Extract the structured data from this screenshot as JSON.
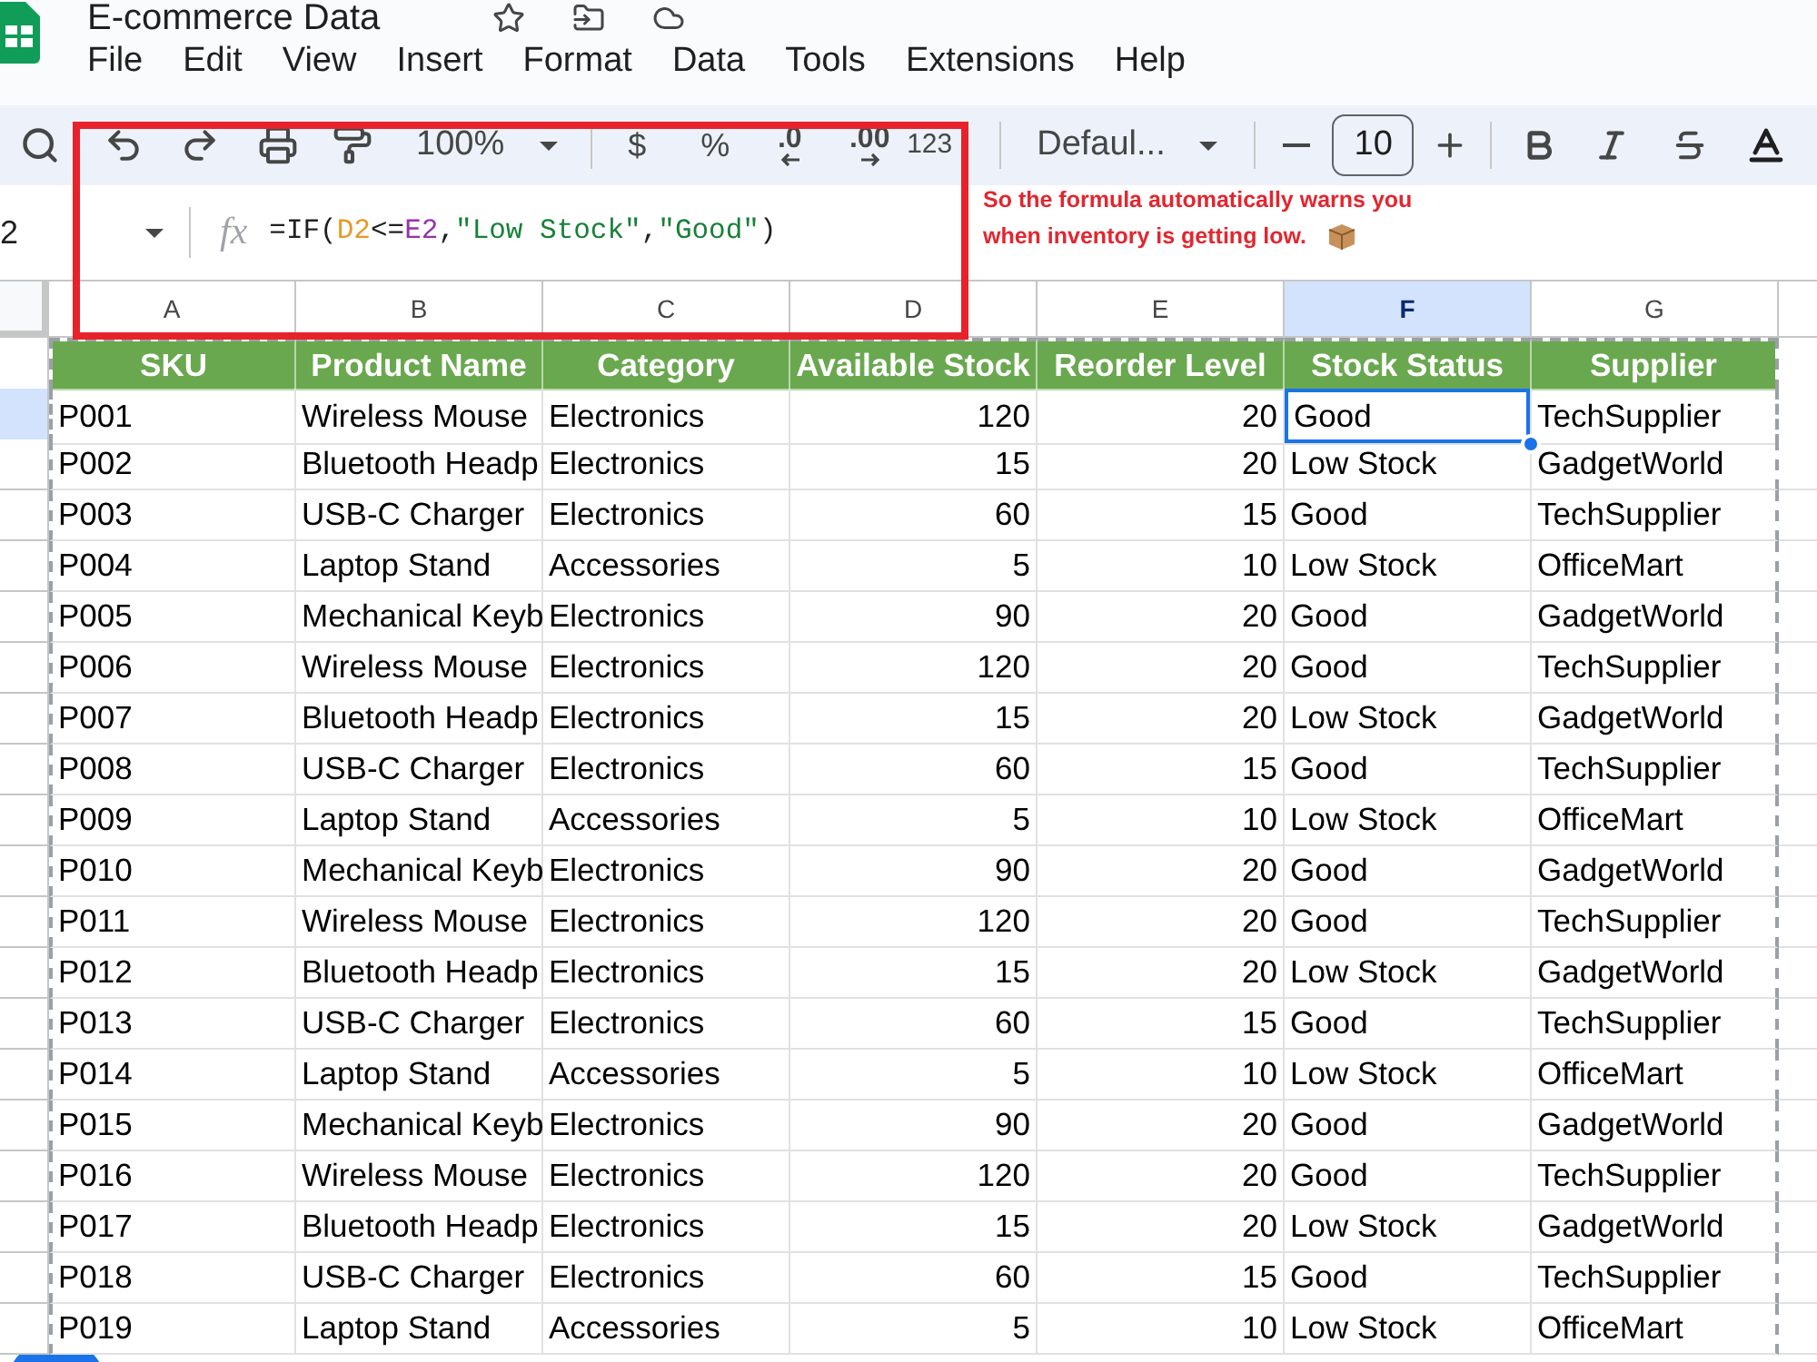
{
  "document": {
    "title": "E-commerce Data"
  },
  "menu": [
    "File",
    "Edit",
    "View",
    "Insert",
    "Format",
    "Data",
    "Tools",
    "Extensions",
    "Help"
  ],
  "toolbar": {
    "zoom": "100%",
    "currency": "$",
    "percent": "%",
    "decrease_decimals": ".0",
    "increase_decimals": ".00",
    "more_formats": "123",
    "font": "Defaul...",
    "font_size": "10"
  },
  "formula_bar": {
    "name_box": "2",
    "function_label": "fx",
    "formula": [
      {
        "text": "=IF(",
        "color": "#1f1f1f"
      },
      {
        "text": "D2",
        "color": "#e69a28"
      },
      {
        "text": "<=",
        "color": "#1f1f1f"
      },
      {
        "text": "E2",
        "color": "#9334a8"
      },
      {
        "text": ",",
        "color": "#1f1f1f"
      },
      {
        "text": "\"Low Stock\"",
        "color": "#188038"
      },
      {
        "text": ",",
        "color": "#1f1f1f"
      },
      {
        "text": "\"Good\"",
        "color": "#188038"
      },
      {
        "text": ")",
        "color": "#1f1f1f"
      }
    ]
  },
  "annotation": {
    "lines": [
      "So the formula automatically warns you",
      "when inventory is getting low."
    ]
  },
  "sheet": {
    "columns": [
      {
        "letter": "A",
        "kind": "text",
        "selected": false
      },
      {
        "letter": "B",
        "kind": "text",
        "selected": false
      },
      {
        "letter": "C",
        "kind": "text",
        "selected": false
      },
      {
        "letter": "D",
        "kind": "number",
        "selected": false
      },
      {
        "letter": "E",
        "kind": "number",
        "selected": false
      },
      {
        "letter": "F",
        "kind": "text",
        "selected": true
      },
      {
        "letter": "G",
        "kind": "text",
        "selected": false
      }
    ],
    "rows": [
      {
        "kind": "header",
        "selected": false,
        "cells": [
          {
            "text": "SKU",
            "selected": false
          },
          {
            "text": "Product Name",
            "selected": false
          },
          {
            "text": "Category",
            "selected": false
          },
          {
            "text": "Available Stock",
            "selected": false
          },
          {
            "text": "Reorder Level",
            "selected": false
          },
          {
            "text": "Stock Status",
            "selected": false
          },
          {
            "text": "Supplier",
            "selected": false
          }
        ]
      },
      {
        "kind": "data",
        "selected": true,
        "cells": [
          {
            "text": "P001",
            "selected": false
          },
          {
            "text": "Wireless Mouse",
            "selected": false
          },
          {
            "text": "Electronics",
            "selected": false
          },
          {
            "text": "120",
            "selected": false
          },
          {
            "text": "20",
            "selected": false
          },
          {
            "text": "Good",
            "selected": true
          },
          {
            "text": "TechSupplier",
            "selected": false
          }
        ]
      },
      {
        "kind": "data",
        "selected": false,
        "cells": [
          {
            "text": "P002",
            "selected": false
          },
          {
            "text": "Bluetooth Headp",
            "selected": false
          },
          {
            "text": "Electronics",
            "selected": false
          },
          {
            "text": "15",
            "selected": false
          },
          {
            "text": "20",
            "selected": false
          },
          {
            "text": "Low Stock",
            "selected": false
          },
          {
            "text": "GadgetWorld",
            "selected": false
          }
        ]
      },
      {
        "kind": "data",
        "selected": false,
        "cells": [
          {
            "text": "P003",
            "selected": false
          },
          {
            "text": "USB-C Charger",
            "selected": false
          },
          {
            "text": "Electronics",
            "selected": false
          },
          {
            "text": "60",
            "selected": false
          },
          {
            "text": "15",
            "selected": false
          },
          {
            "text": "Good",
            "selected": false
          },
          {
            "text": "TechSupplier",
            "selected": false
          }
        ]
      },
      {
        "kind": "data",
        "selected": false,
        "cells": [
          {
            "text": "P004",
            "selected": false
          },
          {
            "text": "Laptop Stand",
            "selected": false
          },
          {
            "text": "Accessories",
            "selected": false
          },
          {
            "text": "5",
            "selected": false
          },
          {
            "text": "10",
            "selected": false
          },
          {
            "text": "Low Stock",
            "selected": false
          },
          {
            "text": "OfficeMart",
            "selected": false
          }
        ]
      },
      {
        "kind": "data",
        "selected": false,
        "cells": [
          {
            "text": "P005",
            "selected": false
          },
          {
            "text": "Mechanical Keyb",
            "selected": false
          },
          {
            "text": "Electronics",
            "selected": false
          },
          {
            "text": "90",
            "selected": false
          },
          {
            "text": "20",
            "selected": false
          },
          {
            "text": "Good",
            "selected": false
          },
          {
            "text": "GadgetWorld",
            "selected": false
          }
        ]
      },
      {
        "kind": "data",
        "selected": false,
        "cells": [
          {
            "text": "P006",
            "selected": false
          },
          {
            "text": "Wireless Mouse",
            "selected": false
          },
          {
            "text": "Electronics",
            "selected": false
          },
          {
            "text": "120",
            "selected": false
          },
          {
            "text": "20",
            "selected": false
          },
          {
            "text": "Good",
            "selected": false
          },
          {
            "text": "TechSupplier",
            "selected": false
          }
        ]
      },
      {
        "kind": "data",
        "selected": false,
        "cells": [
          {
            "text": "P007",
            "selected": false
          },
          {
            "text": "Bluetooth Headp",
            "selected": false
          },
          {
            "text": "Electronics",
            "selected": false
          },
          {
            "text": "15",
            "selected": false
          },
          {
            "text": "20",
            "selected": false
          },
          {
            "text": "Low Stock",
            "selected": false
          },
          {
            "text": "GadgetWorld",
            "selected": false
          }
        ]
      },
      {
        "kind": "data",
        "selected": false,
        "cells": [
          {
            "text": "P008",
            "selected": false
          },
          {
            "text": "USB-C Charger",
            "selected": false
          },
          {
            "text": "Electronics",
            "selected": false
          },
          {
            "text": "60",
            "selected": false
          },
          {
            "text": "15",
            "selected": false
          },
          {
            "text": "Good",
            "selected": false
          },
          {
            "text": "TechSupplier",
            "selected": false
          }
        ]
      },
      {
        "kind": "data",
        "selected": false,
        "cells": [
          {
            "text": "P009",
            "selected": false
          },
          {
            "text": "Laptop Stand",
            "selected": false
          },
          {
            "text": "Accessories",
            "selected": false
          },
          {
            "text": "5",
            "selected": false
          },
          {
            "text": "10",
            "selected": false
          },
          {
            "text": "Low Stock",
            "selected": false
          },
          {
            "text": "OfficeMart",
            "selected": false
          }
        ]
      },
      {
        "kind": "data",
        "selected": false,
        "cells": [
          {
            "text": "P010",
            "selected": false
          },
          {
            "text": "Mechanical Keyb",
            "selected": false
          },
          {
            "text": "Electronics",
            "selected": false
          },
          {
            "text": "90",
            "selected": false
          },
          {
            "text": "20",
            "selected": false
          },
          {
            "text": "Good",
            "selected": false
          },
          {
            "text": "GadgetWorld",
            "selected": false
          }
        ]
      },
      {
        "kind": "data",
        "selected": false,
        "cells": [
          {
            "text": "P011",
            "selected": false
          },
          {
            "text": "Wireless Mouse",
            "selected": false
          },
          {
            "text": "Electronics",
            "selected": false
          },
          {
            "text": "120",
            "selected": false
          },
          {
            "text": "20",
            "selected": false
          },
          {
            "text": "Good",
            "selected": false
          },
          {
            "text": "TechSupplier",
            "selected": false
          }
        ]
      },
      {
        "kind": "data",
        "selected": false,
        "cells": [
          {
            "text": "P012",
            "selected": false
          },
          {
            "text": "Bluetooth Headp",
            "selected": false
          },
          {
            "text": "Electronics",
            "selected": false
          },
          {
            "text": "15",
            "selected": false
          },
          {
            "text": "20",
            "selected": false
          },
          {
            "text": "Low Stock",
            "selected": false
          },
          {
            "text": "GadgetWorld",
            "selected": false
          }
        ]
      },
      {
        "kind": "data",
        "selected": false,
        "cells": [
          {
            "text": "P013",
            "selected": false
          },
          {
            "text": "USB-C Charger",
            "selected": false
          },
          {
            "text": "Electronics",
            "selected": false
          },
          {
            "text": "60",
            "selected": false
          },
          {
            "text": "15",
            "selected": false
          },
          {
            "text": "Good",
            "selected": false
          },
          {
            "text": "TechSupplier",
            "selected": false
          }
        ]
      },
      {
        "kind": "data",
        "selected": false,
        "cells": [
          {
            "text": "P014",
            "selected": false
          },
          {
            "text": "Laptop Stand",
            "selected": false
          },
          {
            "text": "Accessories",
            "selected": false
          },
          {
            "text": "5",
            "selected": false
          },
          {
            "text": "10",
            "selected": false
          },
          {
            "text": "Low Stock",
            "selected": false
          },
          {
            "text": "OfficeMart",
            "selected": false
          }
        ]
      },
      {
        "kind": "data",
        "selected": false,
        "cells": [
          {
            "text": "P015",
            "selected": false
          },
          {
            "text": "Mechanical Keyb",
            "selected": false
          },
          {
            "text": "Electronics",
            "selected": false
          },
          {
            "text": "90",
            "selected": false
          },
          {
            "text": "20",
            "selected": false
          },
          {
            "text": "Good",
            "selected": false
          },
          {
            "text": "GadgetWorld",
            "selected": false
          }
        ]
      },
      {
        "kind": "data",
        "selected": false,
        "cells": [
          {
            "text": "P016",
            "selected": false
          },
          {
            "text": "Wireless Mouse",
            "selected": false
          },
          {
            "text": "Electronics",
            "selected": false
          },
          {
            "text": "120",
            "selected": false
          },
          {
            "text": "20",
            "selected": false
          },
          {
            "text": "Good",
            "selected": false
          },
          {
            "text": "TechSupplier",
            "selected": false
          }
        ]
      },
      {
        "kind": "data",
        "selected": false,
        "cells": [
          {
            "text": "P017",
            "selected": false
          },
          {
            "text": "Bluetooth Headp",
            "selected": false
          },
          {
            "text": "Electronics",
            "selected": false
          },
          {
            "text": "15",
            "selected": false
          },
          {
            "text": "20",
            "selected": false
          },
          {
            "text": "Low Stock",
            "selected": false
          },
          {
            "text": "GadgetWorld",
            "selected": false
          }
        ]
      },
      {
        "kind": "data",
        "selected": false,
        "cells": [
          {
            "text": "P018",
            "selected": false
          },
          {
            "text": "USB-C Charger",
            "selected": false
          },
          {
            "text": "Electronics",
            "selected": false
          },
          {
            "text": "60",
            "selected": false
          },
          {
            "text": "15",
            "selected": false
          },
          {
            "text": "Good",
            "selected": false
          },
          {
            "text": "TechSupplier",
            "selected": false
          }
        ]
      },
      {
        "kind": "data",
        "selected": false,
        "cells": [
          {
            "text": "P019",
            "selected": false
          },
          {
            "text": "Laptop Stand",
            "selected": false
          },
          {
            "text": "Accessories",
            "selected": false
          },
          {
            "text": "5",
            "selected": false
          },
          {
            "text": "10",
            "selected": false
          },
          {
            "text": "Low Stock",
            "selected": false
          },
          {
            "text": "OfficeMart",
            "selected": false
          }
        ]
      }
    ]
  }
}
